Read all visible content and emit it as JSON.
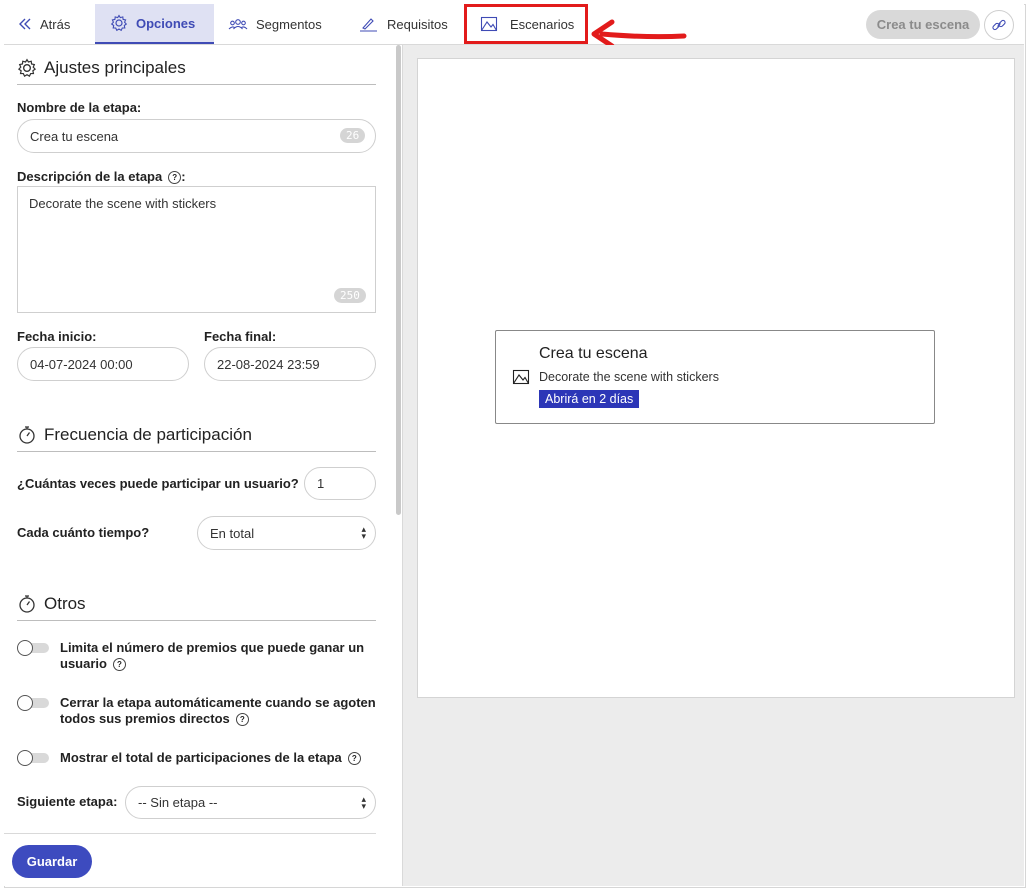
{
  "nav": {
    "back_label": "Atrás",
    "tabs": [
      {
        "label": "Opciones",
        "icon": "gear-icon"
      },
      {
        "label": "Segmentos",
        "icon": "people-icon"
      },
      {
        "label": "Requisitos",
        "icon": "pen-icon"
      },
      {
        "label": "Escenarios",
        "icon": "scene-icon"
      }
    ],
    "active_tab": "Opciones",
    "stage_button": "Crea tu escena",
    "link_icon": "link-icon"
  },
  "main_settings": {
    "title": "Ajustes principales",
    "name_label": "Nombre de la etapa:",
    "name_value": "Crea tu escena",
    "name_counter": "26",
    "description_label": "Descripción de la etapa",
    "description_suffix": ":",
    "description_value": "Decorate the scene with stickers",
    "description_counter": "250",
    "start_label": "Fecha inicio:",
    "start_value": "04-07-2024 00:00",
    "end_label": "Fecha final:",
    "end_value": "22-08-2024 23:59"
  },
  "frequency": {
    "title": "Frecuencia de participación",
    "times_label": "¿Cuántas veces puede participar un usuario?",
    "times_value": "1",
    "period_label": "Cada cuánto tiempo?",
    "period_value": "En total"
  },
  "others": {
    "title": "Otros",
    "toggle1": "Limita el número de premios que puede ganar un usuario",
    "toggle1_line1": "Limita el número de premios que puede ganar un",
    "toggle1_line2": "usuario",
    "toggle2_line1": "Cerrar la etapa automáticamente cuando se agoten",
    "toggle2_line2": "todos sus premios directos",
    "toggle3": "Mostrar el total de participaciones de la etapa",
    "next_stage_label": "Siguiente etapa:",
    "next_stage_value": "-- Sin etapa --"
  },
  "save_label": "Guardar",
  "preview": {
    "title": "Crea tu escena",
    "description": "Decorate the scene with stickers",
    "badge": "Abrirá en 2 días",
    "badge_color": "#2c36b7"
  },
  "colors": {
    "accent": "#3d4bbf",
    "highlight": "#e21b1b"
  }
}
